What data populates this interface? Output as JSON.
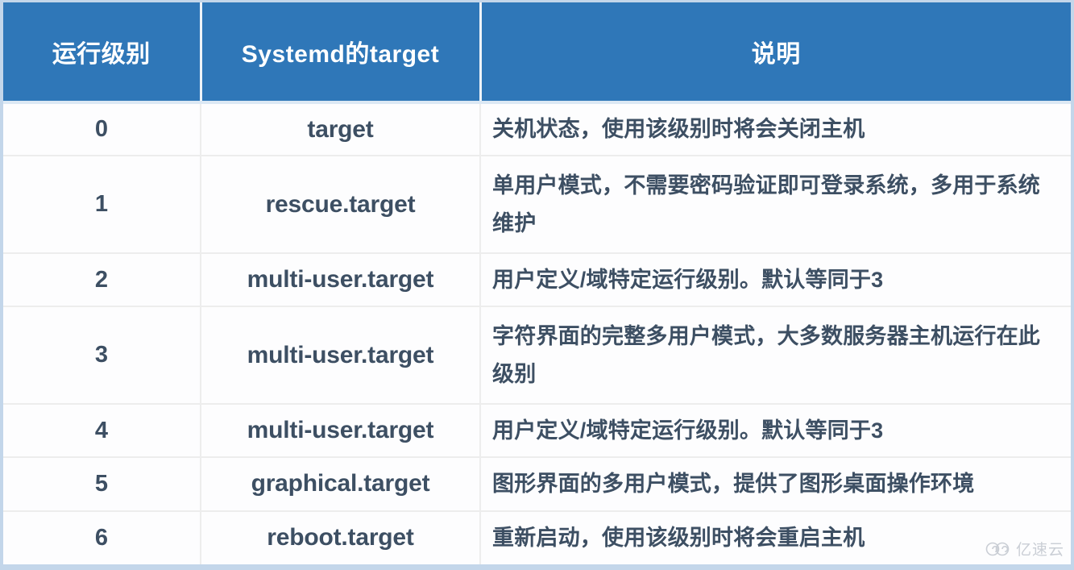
{
  "table": {
    "headers": [
      {
        "key": "level",
        "label": "运行级别"
      },
      {
        "key": "target",
        "label": "Systemd的target"
      },
      {
        "key": "desc",
        "label": "说明"
      }
    ],
    "rows": [
      {
        "level": "0",
        "target": "target",
        "desc": "关机状态，使用该级别时将会关闭主机"
      },
      {
        "level": "1",
        "target": "rescue.target",
        "desc": "单用户模式，不需要密码验证即可登录系统，多用于系统维护"
      },
      {
        "level": "2",
        "target": "multi-user.target",
        "desc": "用户定义/域特定运行级别。默认等同于3"
      },
      {
        "level": "3",
        "target": "multi-user.target",
        "desc": "字符界面的完整多用户模式，大多数服务器主机运行在此级别"
      },
      {
        "level": "4",
        "target": "multi-user.target",
        "desc": "用户定义/域特定运行级别。默认等同于3"
      },
      {
        "level": "5",
        "target": "graphical.target",
        "desc": "图形界面的多用户模式，提供了图形桌面操作环境"
      },
      {
        "level": "6",
        "target": "reboot.target",
        "desc": "重新启动，使用该级别时将会重启主机"
      }
    ]
  },
  "watermark": {
    "text": "亿速云",
    "icon": "cloud-spiral-icon"
  },
  "colors": {
    "header_background": "#2f77b8",
    "header_text": "#ffffff",
    "body_text": "#3d4f63",
    "body_background": "#fdfdfe",
    "grid_line": "#ededed",
    "outer_border": "#c3d6ea",
    "watermark_text": "#b9bfc8"
  }
}
